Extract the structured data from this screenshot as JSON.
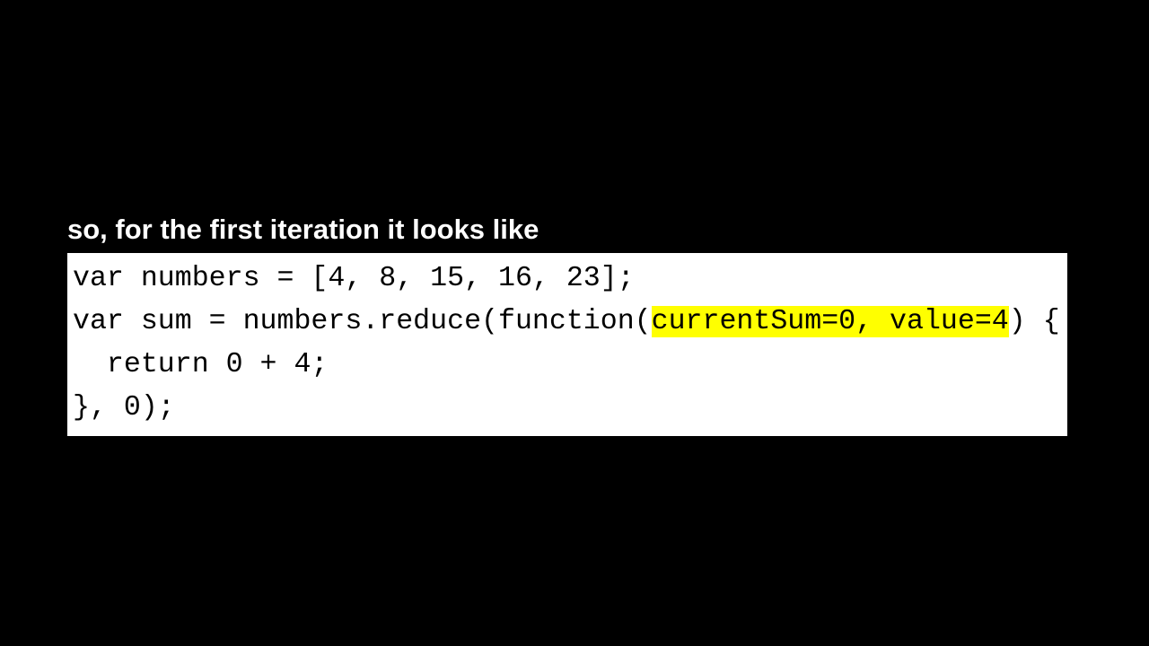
{
  "slide": {
    "heading": "so, for the first iteration it looks like",
    "colors": {
      "background": "#000000",
      "heading_text": "#ffffff",
      "code_background": "#ffffff",
      "code_text": "#000000",
      "highlight": "#ffff00"
    }
  },
  "code": {
    "line1": "var numbers = [4, 8, 15, 16, 23];",
    "line2_before": "var sum = numbers.reduce(function(",
    "line2_highlight": "currentSum=0, value=4",
    "line2_after": ") {",
    "line3": "  return 0 + 4;",
    "line4": "}, 0);"
  }
}
